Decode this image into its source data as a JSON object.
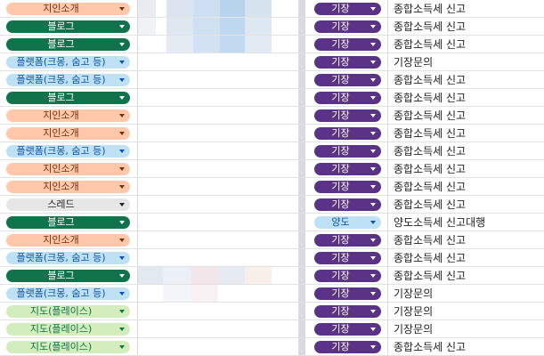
{
  "colors": {
    "blog": {
      "bg": "#11734b",
      "fg": "#ffffff"
    },
    "acquaintance": {
      "bg": "#ffc8aa",
      "fg": "#7a2e0b"
    },
    "platform": {
      "bg": "#bfe1f6",
      "fg": "#0a53a8"
    },
    "thread": {
      "bg": "#e6e6e6",
      "fg": "#202124"
    },
    "map": {
      "bg": "#d4edbc",
      "fg": "#11734b"
    },
    "bookkeeping": {
      "bg": "#5a3286",
      "fg": "#ffffff"
    },
    "transfer": {
      "bg": "#bfe1f6",
      "fg": "#0a53a8"
    },
    "dropdown_icon": "triangle-down"
  },
  "rows": [
    {
      "source": "지인소개",
      "source_style": "acquaintance",
      "type": "기장",
      "type_style": "bookkeeping",
      "service": "종합소득세 신고"
    },
    {
      "source": "블로그",
      "source_style": "blog",
      "type": "기장",
      "type_style": "bookkeeping",
      "service": "종합소득세 신고"
    },
    {
      "source": "블로그",
      "source_style": "blog",
      "type": "기장",
      "type_style": "bookkeeping",
      "service": "종합소득세 신고"
    },
    {
      "source": "플랫폼(크몽, 숨고 등)",
      "source_style": "platform",
      "type": "기장",
      "type_style": "bookkeeping",
      "service": "기장문의"
    },
    {
      "source": "플랫폼(크몽, 숨고 등)",
      "source_style": "platform",
      "type": "기장",
      "type_style": "bookkeeping",
      "service": "종합소득세 신고"
    },
    {
      "source": "블로그",
      "source_style": "blog",
      "type": "기장",
      "type_style": "bookkeeping",
      "service": "종합소득세 신고"
    },
    {
      "source": "지인소개",
      "source_style": "acquaintance",
      "type": "기장",
      "type_style": "bookkeeping",
      "service": "종합소득세 신고"
    },
    {
      "source": "지인소개",
      "source_style": "acquaintance",
      "type": "기장",
      "type_style": "bookkeeping",
      "service": "종합소득세 신고"
    },
    {
      "source": "플랫폼(크몽, 숨고 등)",
      "source_style": "platform",
      "type": "기장",
      "type_style": "bookkeeping",
      "service": "종합소득세 신고"
    },
    {
      "source": "지인소개",
      "source_style": "acquaintance",
      "type": "기장",
      "type_style": "bookkeeping",
      "service": "종합소득세 신고"
    },
    {
      "source": "지인소개",
      "source_style": "acquaintance",
      "type": "기장",
      "type_style": "bookkeeping",
      "service": "종합소득세 신고"
    },
    {
      "source": "스레드",
      "source_style": "thread",
      "type": "기장",
      "type_style": "bookkeeping",
      "service": "종합소득세 신고"
    },
    {
      "source": "블로그",
      "source_style": "blog",
      "type": "양도",
      "type_style": "transfer",
      "service": "양도소득세 신고대행"
    },
    {
      "source": "지인소개",
      "source_style": "acquaintance",
      "type": "기장",
      "type_style": "bookkeeping",
      "service": "종합소득세 신고"
    },
    {
      "source": "플랫폼(크몽, 숨고 등)",
      "source_style": "platform",
      "type": "기장",
      "type_style": "bookkeeping",
      "service": "종합소득세 신고"
    },
    {
      "source": "블로그",
      "source_style": "blog",
      "type": "기장",
      "type_style": "bookkeeping",
      "service": "종합소득세 신고"
    },
    {
      "source": "플랫폼(크몽, 숨고 등)",
      "source_style": "platform",
      "type": "기장",
      "type_style": "bookkeeping",
      "service": "기장문의"
    },
    {
      "source": "지도(플레이스)",
      "source_style": "map",
      "type": "기장",
      "type_style": "bookkeeping",
      "service": "기장문의"
    },
    {
      "source": "지도(플레이스)",
      "source_style": "map",
      "type": "기장",
      "type_style": "bookkeeping",
      "service": "기장문의"
    },
    {
      "source": "지도(플레이스)",
      "source_style": "map",
      "type": "기장",
      "type_style": "bookkeeping",
      "service": "종합소득세 신고"
    }
  ]
}
